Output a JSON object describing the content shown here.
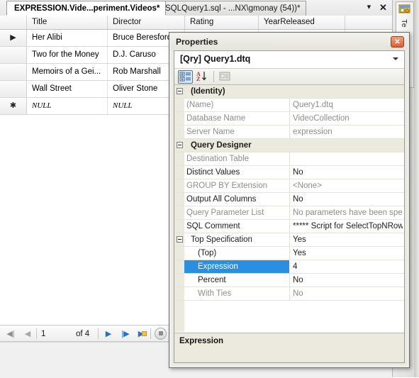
{
  "window": {
    "tabs": [
      {
        "label": "EXPRESSION.Vide...periment.Videos*",
        "active": true
      },
      {
        "label": "SQLQuery1.sql - ...NX\\gmonay (54))*",
        "active": false
      }
    ],
    "tabstrip_buttons": {
      "dropdown": "▾",
      "close": "✕"
    }
  },
  "grid": {
    "columns": [
      "Title",
      "Director",
      "Rating",
      "YearReleased"
    ],
    "rows": [
      {
        "marker": "▶",
        "Title": "Her Alibi",
        "Director": "Bruce Beresford",
        "Rating": "",
        "YearReleased": ""
      },
      {
        "marker": "",
        "Title": "Two for the Money",
        "Director": "D.J. Caruso",
        "Rating": "",
        "YearReleased": ""
      },
      {
        "marker": "",
        "Title": "Memoirs of a Gei...",
        "Director": "Rob Marshall",
        "Rating": "",
        "YearReleased": ""
      },
      {
        "marker": "",
        "Title": "Wall Street",
        "Director": "Oliver Stone",
        "Rating": "",
        "YearReleased": ""
      },
      {
        "marker": "✱",
        "Title": "NULL",
        "Director": "NULL",
        "Rating": "",
        "YearReleased": "",
        "is_null": true
      }
    ]
  },
  "navigator": {
    "first": "◀|",
    "prev": "◀",
    "current_record": "1",
    "of_label": "of 4",
    "next": "▶",
    "last": "|▶",
    "new_record": "▶",
    "stop": "stop-icon"
  },
  "dock": {
    "tab_label": "Te",
    "tab_icon": "template-explorer-icon"
  },
  "properties": {
    "title": "Properties",
    "close_label": "✕",
    "object_selector": "[Qry] Query1.dtq",
    "toolbar": {
      "categorized": "categorized-view-icon",
      "alphabetical": "alphabetical-sort-icon",
      "property_pages": "property-pages-icon"
    },
    "rows": [
      {
        "type": "category",
        "name": "(Identity)",
        "value": "",
        "expanded": true
      },
      {
        "type": "prop",
        "name": "(Name)",
        "value": "Query1.dtq",
        "dim_name": true,
        "dim_value": true
      },
      {
        "type": "prop",
        "name": "Database Name",
        "value": "VideoCollection",
        "dim_name": true,
        "dim_value": true
      },
      {
        "type": "prop",
        "name": "Server Name",
        "value": "expression",
        "dim_name": true,
        "dim_value": true
      },
      {
        "type": "category",
        "name": "Query Designer",
        "value": "",
        "expanded": true
      },
      {
        "type": "prop",
        "name": "Destination Table",
        "value": "",
        "dim_name": true,
        "dim_value": true
      },
      {
        "type": "prop",
        "name": "Distinct Values",
        "value": "No",
        "dim_name": false,
        "dim_value": false
      },
      {
        "type": "prop",
        "name": "GROUP BY Extension",
        "value": "<None>",
        "dim_name": true,
        "dim_value": true
      },
      {
        "type": "prop",
        "name": "Output All Columns",
        "value": "No",
        "dim_name": false,
        "dim_value": false
      },
      {
        "type": "prop",
        "name": "Query Parameter List",
        "value": "No parameters have been specified",
        "dim_name": true,
        "dim_value": true
      },
      {
        "type": "prop",
        "name": "SQL Comment",
        "value": "***** Script for SelectTopNRows co",
        "dim_name": false,
        "dim_value": false
      },
      {
        "type": "category",
        "name": "Top Specification",
        "value": "Yes",
        "expanded": true,
        "plain_cat": true
      },
      {
        "type": "prop",
        "name": "(Top)",
        "value": "Yes",
        "indent": true,
        "dim_name": false,
        "dim_value": false
      },
      {
        "type": "prop",
        "name": "Expression",
        "value": "4",
        "indent": true,
        "selected": true
      },
      {
        "type": "prop",
        "name": "Percent",
        "value": "No",
        "indent": true,
        "dim_name": false,
        "dim_value": false
      },
      {
        "type": "prop",
        "name": "With Ties",
        "value": "No",
        "indent": true,
        "dim_name": true,
        "dim_value": true
      }
    ],
    "description": {
      "title": "Expression",
      "text": ""
    }
  }
}
